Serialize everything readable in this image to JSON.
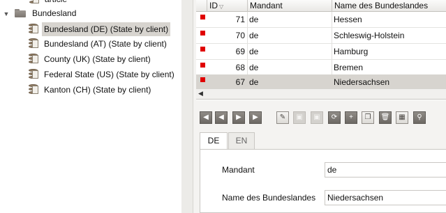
{
  "tree": {
    "partial_label": "article",
    "folder_label": "Bundesland",
    "items": [
      {
        "label": "Bundesland (DE) (State by client)",
        "selected": true
      },
      {
        "label": "Bundesland (AT) (State by client)",
        "selected": false
      },
      {
        "label": "County (UK) (State by client)",
        "selected": false
      },
      {
        "label": "Federal State (US) (State by client)",
        "selected": false
      },
      {
        "label": "Kanton (CH) (State by client)",
        "selected": false
      }
    ]
  },
  "grid": {
    "columns": {
      "id": "ID",
      "mandant": "Mandant",
      "name": "Name des Bundeslandes"
    },
    "rows": [
      {
        "id": "71",
        "mandant": "de",
        "name": "Hessen"
      },
      {
        "id": "70",
        "mandant": "de",
        "name": "Schleswig-Holstein"
      },
      {
        "id": "69",
        "mandant": "de",
        "name": "Hamburg"
      },
      {
        "id": "68",
        "mandant": "de",
        "name": "Bremen"
      },
      {
        "id": "67",
        "mandant": "de",
        "name": "Niedersachsen"
      }
    ],
    "marker_color": "#e00000",
    "selected_row_color": "#d7d4cf"
  },
  "toolbar": {
    "icons": [
      "first-record-icon",
      "previous-record-icon",
      "next-record-icon",
      "last-record-icon",
      "edit-icon",
      "save-icon",
      "save-close-icon",
      "refresh-icon",
      "new-record-icon",
      "copy-icon",
      "delete-icon",
      "table-view-icon",
      "search-icon"
    ]
  },
  "form": {
    "tabs": {
      "de": "DE",
      "en": "EN"
    },
    "fields": {
      "mandant_label": "Mandant",
      "mandant_value": "de",
      "name_label": "Name des Bundeslandes",
      "name_value": "Niedersachsen"
    }
  }
}
